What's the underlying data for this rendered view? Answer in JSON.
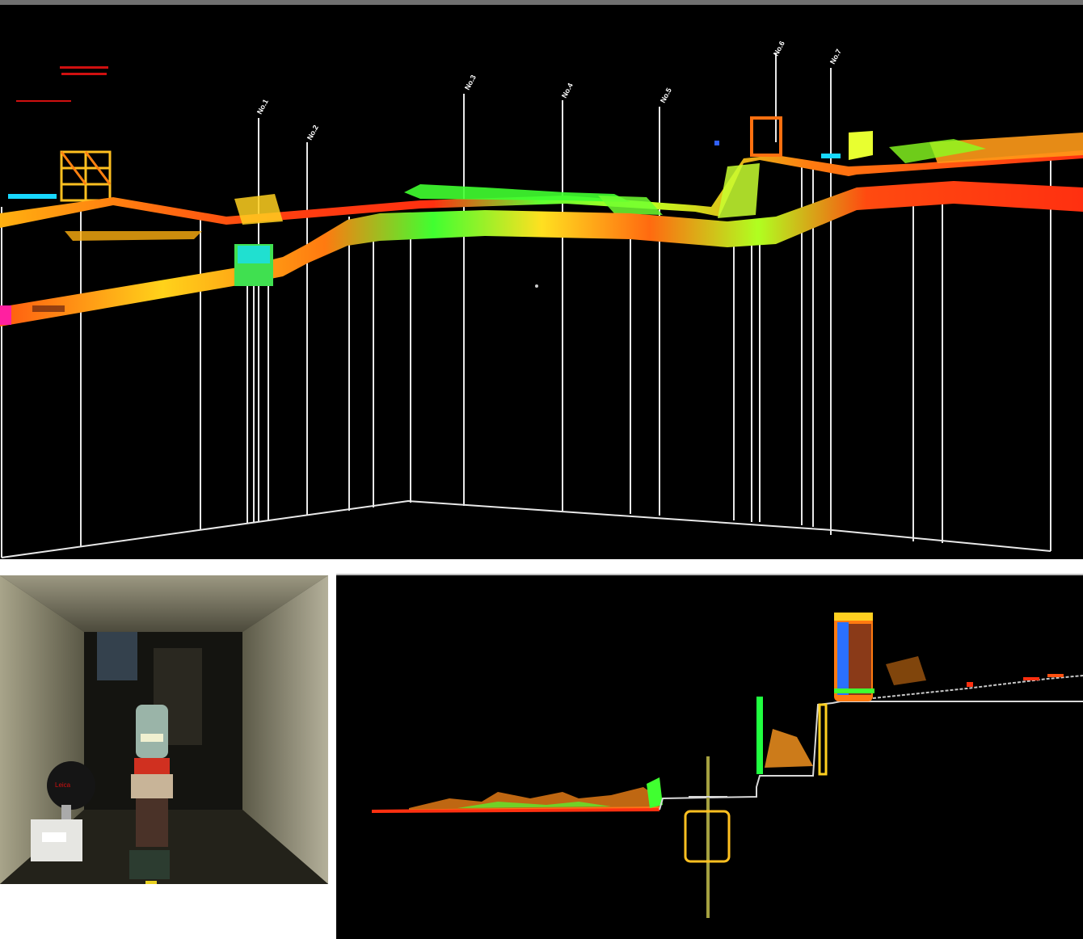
{
  "top_view": {
    "manhole_labels": [
      "No.1",
      "No.2",
      "No.3",
      "No.4",
      "No.5",
      "No.6",
      "No.7"
    ]
  },
  "photo": {
    "scanner_brand": "Leica"
  },
  "colors": {
    "background": "#000000",
    "frame": "#ffffff",
    "high": "#ff3b10",
    "mid": "#ffd21a",
    "low": "#3dff2a",
    "cyan": "#18d8ff"
  }
}
